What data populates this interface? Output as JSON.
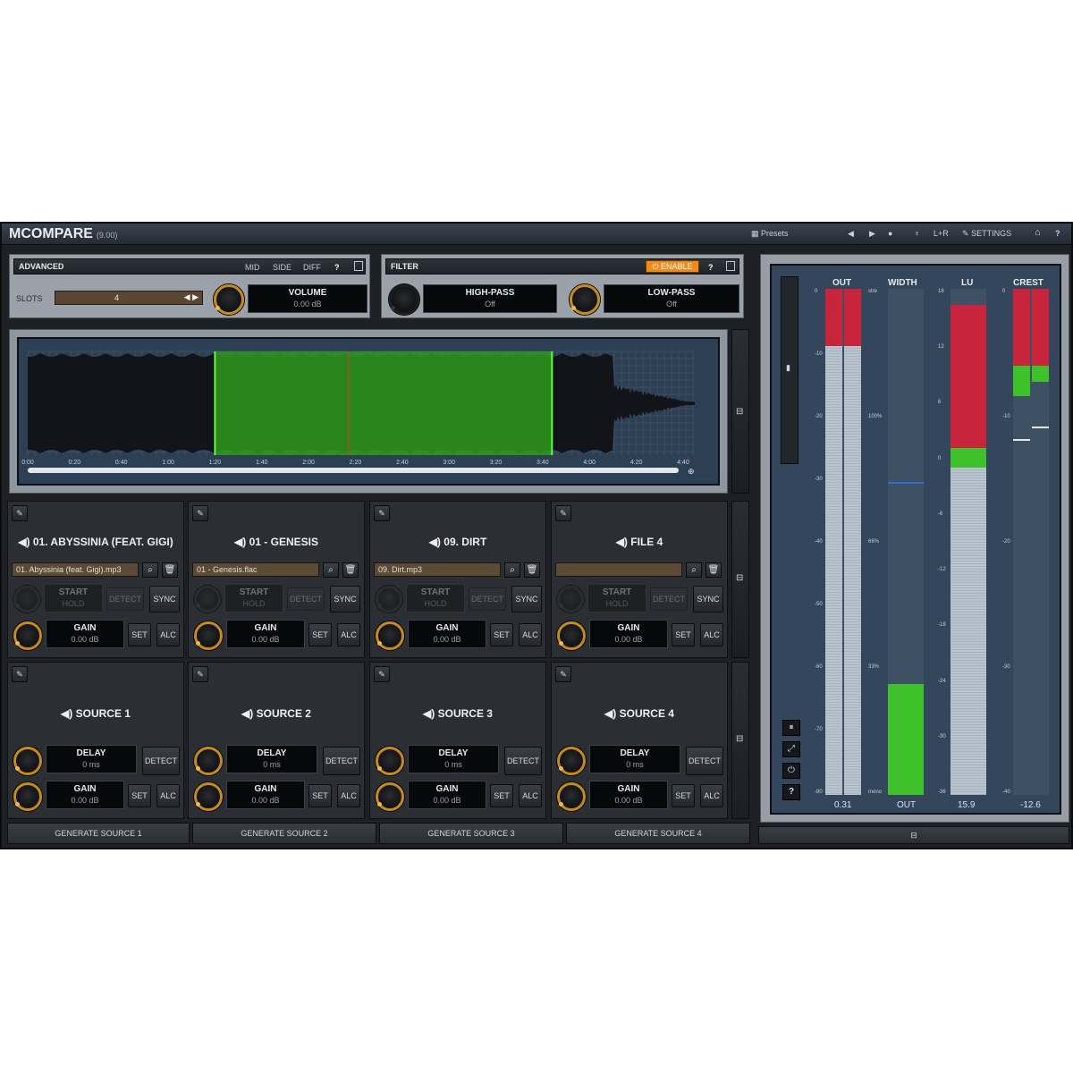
{
  "app": {
    "name": "MCOMPARE",
    "version": "(9.00)"
  },
  "toolbar": {
    "presets": "Presets",
    "prev": "◀",
    "next": "▶",
    "channel": "L+R",
    "settings": "SETTINGS",
    "home": "⌂",
    "help": "?"
  },
  "advanced": {
    "title": "ADVANCED",
    "mid": "MID",
    "side": "SIDE",
    "diff": "DIFF",
    "help": "?",
    "slots_label": "SLOTS",
    "slots_value": "4",
    "volume_label": "VOLUME",
    "volume_value": "0.00 dB"
  },
  "filter": {
    "title": "FILTER",
    "enable": "ENABLE",
    "help": "?",
    "highpass_label": "HIGH-PASS",
    "highpass_value": "Off",
    "lowpass_label": "LOW-PASS",
    "lowpass_value": "Off"
  },
  "timeline": {
    "ticks": [
      "0:00",
      "0:20",
      "0:40",
      "1:00",
      "1:20",
      "1:40",
      "2:00",
      "2:20",
      "2:40",
      "3:00",
      "3:20",
      "3:40",
      "4:00",
      "4:20",
      "4:40"
    ],
    "selection_start_sec": 80,
    "selection_end_sec": 224,
    "duration_sec": 285
  },
  "files": [
    {
      "name": "01. ABYSSINIA (FEAT. GIGI)",
      "file": "01. Abyssinia (feat. Gigi).mp3",
      "start": "START",
      "hold": "HOLD",
      "detect": "DETECT",
      "sync": "SYNC",
      "gain_label": "GAIN",
      "gain_value": "0.00 dB",
      "set": "SET",
      "alc": "ALC"
    },
    {
      "name": "01 - GENESIS",
      "file": "01 - Genesis.flac",
      "start": "START",
      "hold": "HOLD",
      "detect": "DETECT",
      "sync": "SYNC",
      "gain_label": "GAIN",
      "gain_value": "0.00 dB",
      "set": "SET",
      "alc": "ALC"
    },
    {
      "name": "09. DIRT",
      "file": "09. Dirt.mp3",
      "start": "START",
      "hold": "HOLD",
      "detect": "DETECT",
      "sync": "SYNC",
      "gain_label": "GAIN",
      "gain_value": "0.00 dB",
      "set": "SET",
      "alc": "ALC"
    },
    {
      "name": "FILE 4",
      "file": "",
      "start": "START",
      "hold": "HOLD",
      "detect": "DETECT",
      "sync": "SYNC",
      "gain_label": "GAIN",
      "gain_value": "0.00 dB",
      "set": "SET",
      "alc": "ALC"
    }
  ],
  "sources": [
    {
      "name": "SOURCE 1",
      "delay_label": "DELAY",
      "delay_value": "0 ms",
      "detect": "DETECT",
      "gain_label": "GAIN",
      "gain_value": "0.00 dB",
      "set": "SET",
      "alc": "ALC",
      "generate": "GENERATE SOURCE 1"
    },
    {
      "name": "SOURCE 2",
      "delay_label": "DELAY",
      "delay_value": "0 ms",
      "detect": "DETECT",
      "gain_label": "GAIN",
      "gain_value": "0.00 dB",
      "set": "SET",
      "alc": "ALC",
      "generate": "GENERATE SOURCE 2"
    },
    {
      "name": "SOURCE 3",
      "delay_label": "DELAY",
      "delay_value": "0 ms",
      "detect": "DETECT",
      "gain_label": "GAIN",
      "gain_value": "0.00 dB",
      "set": "SET",
      "alc": "ALC",
      "generate": "GENERATE SOURCE 3"
    },
    {
      "name": "SOURCE 4",
      "delay_label": "DELAY",
      "delay_value": "0 ms",
      "detect": "DETECT",
      "gain_label": "GAIN",
      "gain_value": "0.00 dB",
      "set": "SET",
      "alc": "ALC",
      "generate": "GENERATE SOURCE 4"
    }
  ],
  "meters": {
    "out": {
      "label": "OUT",
      "value": "0.31",
      "ticks": [
        "0",
        "-10",
        "-20",
        "-30",
        "-40",
        "-50",
        "-60",
        "-70",
        "-80"
      ]
    },
    "width": {
      "label": "WIDTH",
      "value": "OUT",
      "ticks": [
        "stre",
        "100%",
        "66%",
        "33%",
        "mono"
      ]
    },
    "lu": {
      "label": "LU",
      "value": "15.9",
      "ticks": [
        "18",
        "12",
        "6",
        "0",
        "-6",
        "-12",
        "-18",
        "-24",
        "-30",
        "-36"
      ]
    },
    "crest": {
      "label": "CREST",
      "value": "-12.6",
      "ticks": [
        "0",
        "-10",
        "-20",
        "-30",
        "-40"
      ]
    },
    "buttons": [
      "⏸",
      "⤢",
      "⏻",
      "?"
    ]
  },
  "colors": {
    "accent": "#c58a1c",
    "enable": "#f08a1a",
    "selection": "#3fb21e",
    "meter_red": "#c8243c",
    "meter_green": "#3fc12c",
    "meter_grey": "#b9c4cf"
  }
}
